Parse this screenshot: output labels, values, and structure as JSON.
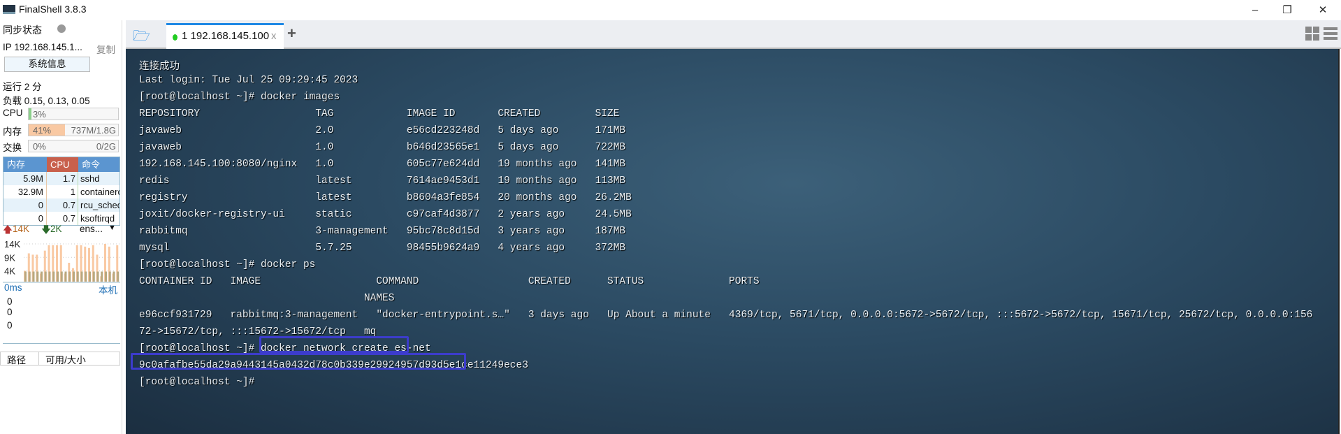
{
  "window": {
    "title": "FinalShell 3.8.3",
    "minimize": "–",
    "maximize": "❐",
    "close": "✕"
  },
  "sidebar": {
    "sync_label": "同步状态",
    "ip": "IP 192.168.145.1...",
    "copy": "复制",
    "sysinfo_button": "系统信息",
    "uptime": "运行 2 分",
    "load": "负载 0.15, 0.13, 0.05",
    "cpu": {
      "label": "CPU",
      "value": "3%",
      "fraction": 0.03
    },
    "mem": {
      "label": "内存",
      "value": "41%",
      "detail": "737M/1.8G",
      "fraction": 0.41
    },
    "swap": {
      "label": "交换",
      "value": "0%",
      "detail": "0/2G",
      "fraction": 0
    },
    "proc_headers": [
      "内存",
      "CPU",
      "命令"
    ],
    "procs": [
      [
        "5.9M",
        "1.7",
        "sshd"
      ],
      [
        "32.9M",
        "1",
        "containerd"
      ],
      [
        "0",
        "0.7",
        "rcu_sched"
      ],
      [
        "0",
        "0.7",
        "ksoftirqd"
      ]
    ],
    "net": {
      "up": "14K",
      "down": "2K",
      "iface": "ens...",
      "ticks": [
        "14K",
        "9K",
        "4K"
      ],
      "max": 14,
      "up_series": [
        4,
        10.5,
        10,
        10,
        3,
        11.5,
        13.5,
        13.5,
        13.5,
        13.5,
        3,
        7,
        5,
        13.5,
        13.5,
        13,
        12.5,
        13.5,
        10,
        2,
        14,
        13,
        3,
        13.5
      ],
      "down_series": [
        1.5,
        1.5,
        1.5,
        1.5,
        1.5,
        1.5,
        1.5,
        1.5,
        1.5,
        1.5,
        1.5,
        1.5,
        1.5,
        1.5,
        1.5,
        1.5,
        1.5,
        1.5,
        1.5,
        1.5,
        1.5,
        1.5,
        1.5,
        1.5
      ]
    },
    "latency": {
      "label": "0ms",
      "host": "本机",
      "values": [
        "0",
        "0",
        "0"
      ]
    },
    "disk_headers": [
      "路径",
      "可用/大小"
    ],
    "colors": {
      "cpu": "#c8604c",
      "mem": "#5b95d0",
      "mem_fill": "#f9c9a3",
      "cpu_fill": "#8cd08c"
    }
  },
  "tabs": {
    "items": [
      {
        "label": "1 192.168.145.100",
        "status": "connected"
      }
    ],
    "add": "+",
    "close": "x"
  },
  "terminal": {
    "lines": [
      "连接成功",
      "Last login: Tue Jul 25 09:29:45 2023",
      "[root@localhost ~]# docker images",
      "REPOSITORY                   TAG            IMAGE ID       CREATED         SIZE",
      "javaweb                      2.0            e56cd223248d   5 days ago      171MB",
      "javaweb                      1.0            b646d23565e1   5 days ago      722MB",
      "192.168.145.100:8080/nginx   1.0            605c77e624dd   19 months ago   141MB",
      "redis                        latest         7614ae9453d1   19 months ago   113MB",
      "registry                     latest         b8604a3fe854   20 months ago   26.2MB",
      "joxit/docker-registry-ui     static         c97caf4d3877   2 years ago     24.5MB",
      "rabbitmq                     3-management   95bc78c8d15d   3 years ago     187MB",
      "mysql                        5.7.25         98455b9624a9   4 years ago     372MB",
      "[root@localhost ~]# docker ps",
      "CONTAINER ID   IMAGE                   COMMAND                  CREATED      STATUS              PORTS",
      "                                     NAMES",
      "e96ccf931729   rabbitmq:3-management   \"docker-entrypoint.s…\"   3 days ago   Up About a minute   4369/tcp, 5671/tcp, 0.0.0.0:5672->5672/tcp, :::5672->5672/tcp, 15671/tcp, 25672/tcp, 0.0.0.0:156",
      "72->15672/tcp, :::15672->15672/tcp   mq",
      "[root@localhost ~]# docker network create es-net",
      "9c0afafbe55da29a9443145a0432d78c0b339e29924957d93d5e1ce11249ece3",
      "[root@localhost ~]# "
    ],
    "highlight_color": "#3c3ccc"
  }
}
